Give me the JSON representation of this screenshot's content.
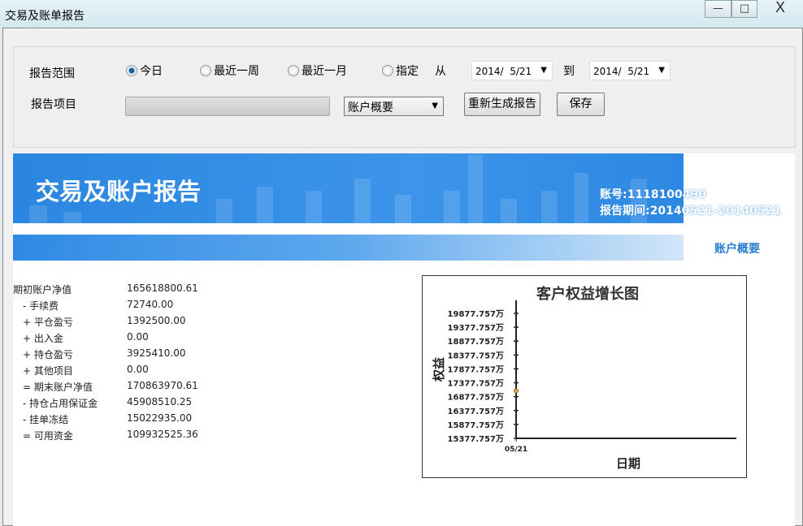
{
  "window": {
    "title": "交易及账单报告",
    "minimize": "—",
    "maximize": "□",
    "close": "X"
  },
  "controls": {
    "range_label": "报告范围",
    "item_label": "报告项目",
    "radios": [
      {
        "label": "今日",
        "checked": true
      },
      {
        "label": "最近一周",
        "checked": false
      },
      {
        "label": "最近一月",
        "checked": false
      },
      {
        "label": "指定",
        "checked": false
      }
    ],
    "from_label": "从",
    "to_label": "到",
    "from_date": "2014/  5/21",
    "to_date": "2014/  5/21",
    "report_item": "账户概要",
    "regenerate": "重新生成报告",
    "save": "保存"
  },
  "report": {
    "banner_title": "交易及账户报告",
    "account": "账号:1118100490",
    "period": "报告期间:20140521-20140521",
    "section": "账户概要",
    "rows": [
      {
        "label": "期初账户净值",
        "value": "165618800.61"
      },
      {
        "label": "- 手续费",
        "value": "72740.00"
      },
      {
        "label": "+ 平仓盈亏",
        "value": "1392500.00"
      },
      {
        "label": "+ 出入金",
        "value": "0.00"
      },
      {
        "label": "+ 持仓盈亏",
        "value": "3925410.00"
      },
      {
        "label": "+ 其他项目",
        "value": "0.00"
      },
      {
        "label": "= 期末账户净值",
        "value": "170863970.61"
      },
      {
        "label": "- 持仓占用保证金",
        "value": "45908510.25"
      },
      {
        "label": "- 挂单冻结",
        "value": "15022935.00"
      },
      {
        "label": "= 可用资金",
        "value": "109932525.36"
      }
    ]
  },
  "chart_data": {
    "type": "line",
    "title": "客户权益增长图",
    "xlabel": "日期",
    "ylabel": "权益",
    "categories": [
      "05/21"
    ],
    "series": [
      {
        "name": "权益",
        "values": [
          17086.397
        ]
      }
    ],
    "yticks": [
      "15377.757万",
      "15877.757万",
      "16377.757万",
      "16877.757万",
      "17377.757万",
      "17877.757万",
      "18377.757万",
      "18877.757万",
      "19377.757万",
      "19877.757万"
    ],
    "ylim": [
      15377.757,
      19877.757
    ],
    "point_color": "#e0a050"
  }
}
